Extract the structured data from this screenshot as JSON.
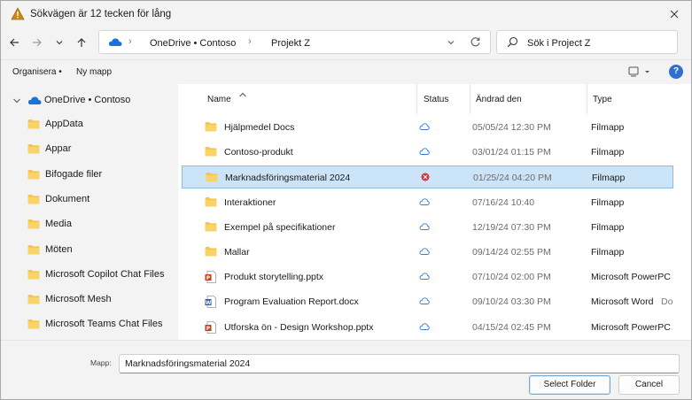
{
  "window": {
    "title": "Sökvägen är 12 tecken för lång"
  },
  "nav": {
    "breadcrumbs": [
      "OneDrive • Contoso",
      "Projekt Z"
    ],
    "search_placeholder": "Sök i Project Z"
  },
  "toolbar": {
    "organize_label": "Organisera •",
    "new_folder_label": "Ny mapp",
    "help_label": "?"
  },
  "sidebar": {
    "root_label": "OneDrive • Contoso",
    "items": [
      {
        "label": "AppData"
      },
      {
        "label": "Appar"
      },
      {
        "label": "Bifogade filer"
      },
      {
        "label": "Dokument"
      },
      {
        "label": "Media"
      },
      {
        "label": "Möten"
      },
      {
        "label": "Microsoft Copilot Chat Files"
      },
      {
        "label": "Microsoft Mesh"
      },
      {
        "label": "Microsoft Teams Chat Files"
      }
    ]
  },
  "columns": {
    "name": "Name",
    "status": "Status",
    "modified": "Ändrad den",
    "type": "Type"
  },
  "files": [
    {
      "name": "Hjälpmedel Docs",
      "kind": "folder",
      "status": "cloud",
      "date": "05/05/24 12:30 PM",
      "type": "Filmapp",
      "extra": ""
    },
    {
      "name": "Contoso-produkt",
      "kind": "folder",
      "status": "cloud",
      "date": "03/01/24 01:15 PM",
      "type": "Filmapp",
      "extra": ""
    },
    {
      "name": "Marknadsföringsmaterial 2024",
      "kind": "folder",
      "status": "error",
      "date": "01/25/24 04:20 PM",
      "type": "Filmapp",
      "extra": "",
      "selected": true
    },
    {
      "name": "Interaktioner",
      "kind": "folder",
      "status": "cloud",
      "date": "07/16/24 10:40",
      "type": "Filmapp",
      "extra": ""
    },
    {
      "name": "Exempel på specifikationer",
      "kind": "folder",
      "status": "cloud",
      "date": "12/19/24 07:30 PM",
      "type": "Filmapp",
      "extra": ""
    },
    {
      "name": "Mallar",
      "kind": "folder",
      "status": "cloud",
      "date": "09/14/24 02:55 PM",
      "type": "Filmapp",
      "extra": ""
    },
    {
      "name": "Produkt storytelling.pptx",
      "kind": "pptx",
      "status": "cloud",
      "date": "07/10/24 02:00 PM",
      "type": "Microsoft PowerPC",
      "extra": ""
    },
    {
      "name": "Program Evaluation Report.docx",
      "kind": "docx",
      "status": "cloud",
      "date": "09/10/24 03:30 PM",
      "type": "Microsoft Word",
      "extra": "Do"
    },
    {
      "name": "Utforska ön - Design Workshop.pptx",
      "kind": "pptx",
      "status": "cloud",
      "date": "04/15/24 02:45 PM",
      "type": "Microsoft PowerPC",
      "extra": ""
    }
  ],
  "footer": {
    "folder_label": "Mapp:",
    "folder_value": "Marknadsföringsmaterial 2024",
    "select_label": "Select Folder",
    "cancel_label": "Cancel"
  },
  "colors": {
    "accent": "#2f6fd0",
    "selection": "#cce4f7",
    "folder": "#f4c64e",
    "error": "#d13438"
  }
}
